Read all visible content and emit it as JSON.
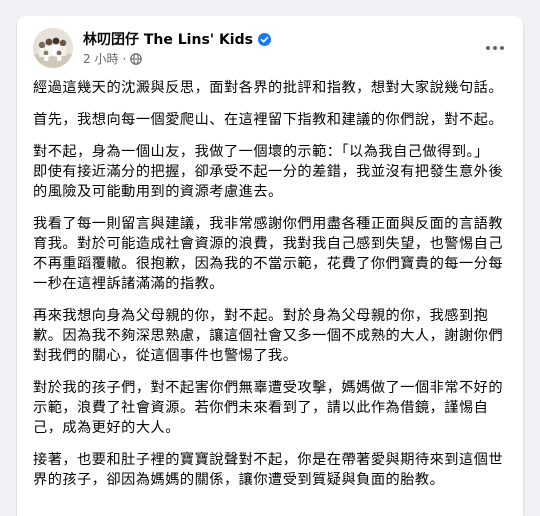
{
  "post": {
    "author": "林叨囝仔 The Lins' Kids",
    "timestamp": "2 小時",
    "separator": "·",
    "paragraphs": [
      "經過這幾天的沈澱與反思，面對各界的批評和指教，想對大家說幾句話。",
      "首先，我想向每一個愛爬山、在這裡留下指教和建議的你們說，對不起。",
      "對不起，身為一個山友，我做了一個壞的示範：「以為我自己做得到。」即使有接近滿分的把握，卻承受不起一分的差錯，我並沒有把發生意外後的風險及可能動用到的資源考慮進去。",
      "我看了每一則留言與建議，我非常感謝你們用盡各種正面與反面的言語教育我。對於可能造成社會資源的浪費，我對我自己感到失望，也警惕自己不再重蹈覆轍。很抱歉，因為我的不當示範，花費了你們寶貴的每一分每一秒在這裡訴諸滿滿的指教。",
      "再來我想向身為父母親的你，對不起。對於身為父母親的你，我感到抱歉。因為我不夠深思熟慮，讓這個社會又多一個不成熟的大人，謝謝你們對我們的關心，從這個事件也警惕了我。",
      "對於我的孩子們，對不起害你們無辜遭受攻擊，媽媽做了一個非常不好的示範，浪費了社會資源。若你們未來看到了，請以此作為借鏡，謹惕自己，成為更好的大人。",
      "接著，也要和肚子裡的寶寶說聲對不起，你是在帶著愛與期待來到這個世界的孩子，卻因為媽媽的關係，讓你遭受到質疑與負面的胎教。"
    ]
  },
  "icons": {
    "avatar": "group-photo-avatar",
    "verified": "verified-badge-icon",
    "audience": "globe-icon",
    "more": "more-options-icon"
  },
  "colors": {
    "background": "#f0f2f5",
    "card": "#ffffff",
    "text": "#050505",
    "secondary": "#65676b",
    "verified": "#1877f2"
  }
}
